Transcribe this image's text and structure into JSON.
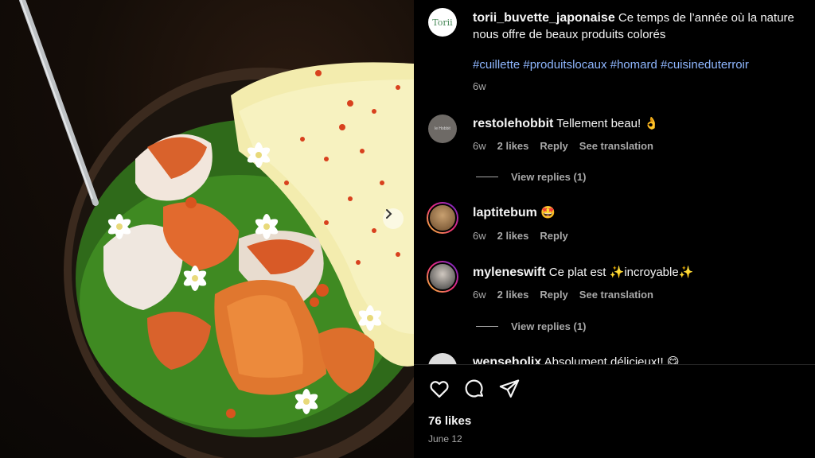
{
  "post": {
    "author": "torii_buvette_japonaise",
    "avatar_text": "Torii",
    "caption_line1": "Ce temps de l’année où la nature",
    "caption_line2": "nous offre de beaux produits colorés",
    "hashtags": [
      "#cuillette",
      "#produitslocaux",
      "#homard",
      "#cuisineduterroir"
    ],
    "age": "6w",
    "likes": "76 likes",
    "date": "June 12"
  },
  "comments": [
    {
      "user": "restolehobbit",
      "avatar_text": "le Hobbit",
      "text": "Tellement beau! 👌",
      "age": "6w",
      "likes": "2 likes",
      "reply": "Reply",
      "translate": "See translation",
      "view_replies": "View replies (1)"
    },
    {
      "user": "laptitebum",
      "text": "🤩",
      "age": "6w",
      "likes": "2 likes",
      "reply": "Reply"
    },
    {
      "user": "myleneswift",
      "text": "Ce plat est ✨incroyable✨",
      "age": "6w",
      "likes": "2 likes",
      "reply": "Reply",
      "translate": "See translation",
      "view_replies": "View replies (1)"
    },
    {
      "user": "wenseholix",
      "text": "Absolument délicieux!! 😋"
    }
  ],
  "icons": [
    "heart-icon",
    "comment-icon",
    "share-icon",
    "chevron-right-icon"
  ],
  "colors": {
    "hashtag": "#8fb7ff",
    "muted": "#a8a8a8",
    "panel_bg": "#000000"
  }
}
